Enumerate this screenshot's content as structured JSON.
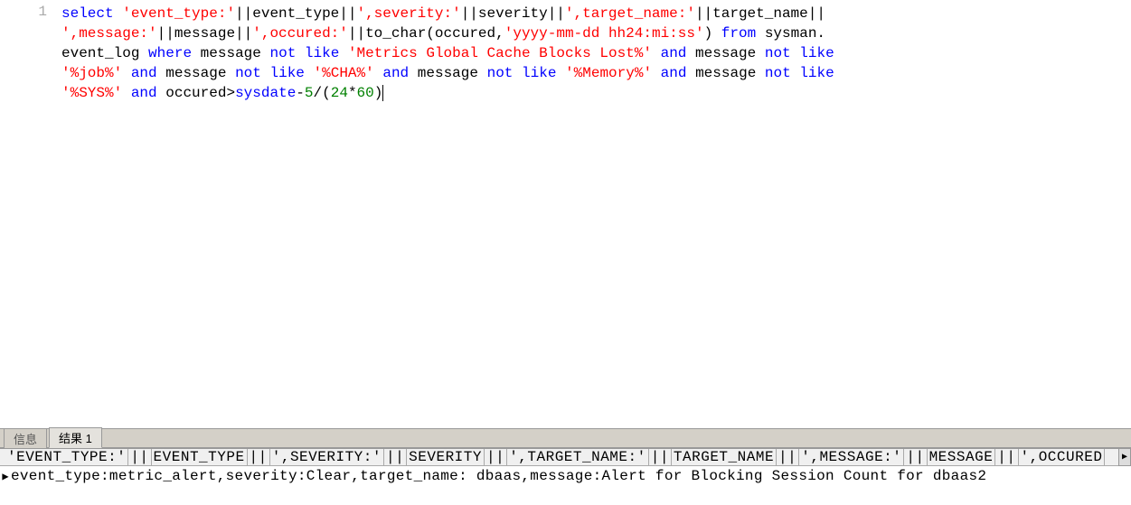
{
  "editor": {
    "lineNumber": "1",
    "t_select": "select",
    "s_event_type": "'event_type:'",
    "s_severity": "',severity:'",
    "s_target_name": "',target_name:'",
    "s_message": "',message:'",
    "s_occured": "',occured:'",
    "s_fmt": "'yyyy-mm-dd hh24:mi:ss'",
    "t_from": "from",
    "t_where": "where",
    "t_not1": "not",
    "t_like1": "like",
    "s_metrics": "'Metrics Global Cache Blocks Lost%'",
    "t_and1": "and",
    "t_not2": "not",
    "t_like2": "like",
    "s_job": "'%job%'",
    "t_and2": "and",
    "t_not3": "not",
    "t_like3": "like",
    "s_cha": "'%CHA%'",
    "t_and3": "and",
    "t_not4": "not",
    "t_like4": "like",
    "s_memory": "'%Memory%'",
    "t_and4": "and",
    "t_not5": "not",
    "t_like5": "like",
    "s_sys": "'%SYS%'",
    "t_and5": "and",
    "id_sysdate": "sysdate",
    "n5": "5",
    "n24": "24",
    "n60": "60",
    "id_event_type": "event_type",
    "id_severity": "severity",
    "id_target_name": "target_name",
    "id_message": "message",
    "id_to_char": "to_char",
    "id_occured": "occured",
    "id_sysman": "sysman",
    "id_event_log": "event_log",
    "pp_concat": "||",
    "pp_comma": ",",
    "pp_open": "(",
    "pp_close": ")",
    "pp_dot": ".",
    "pp_gt": ">",
    "pp_minus": "-",
    "pp_div": "/",
    "pp_star": "*"
  },
  "tabs": {
    "info": "信息",
    "results": "结果 1"
  },
  "results": {
    "h1": "'EVENT_TYPE:'",
    "h2": "EVENT_TYPE",
    "h3": "',SEVERITY:'",
    "h4": "SEVERITY",
    "h5": "',TARGET_NAME:'",
    "h6": "TARGET_NAME",
    "h7": "',MESSAGE:'",
    "h8": "MESSAGE",
    "h9": "',OCCURED",
    "sep": "||",
    "row1": "event_type:metric_alert,severity:Clear,target_name:  dbaas,message:Alert for Blocking Session Count for   dbaas2",
    "marker": "▶"
  }
}
